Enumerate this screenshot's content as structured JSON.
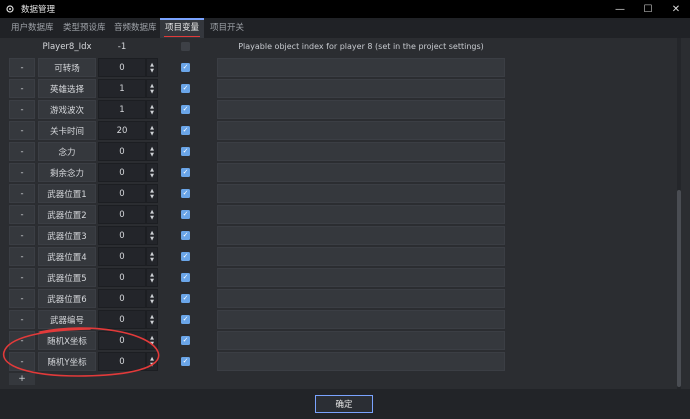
{
  "window": {
    "title": "数据管理",
    "icon": "gear-cog-icon"
  },
  "controls": {
    "minimize": "—",
    "maximize": "☐",
    "close": "✕"
  },
  "tabs": [
    {
      "label": "用户数据库"
    },
    {
      "label": "类型预设库"
    },
    {
      "label": "音频数据库"
    },
    {
      "label": "项目变量"
    },
    {
      "label": "项目开关"
    }
  ],
  "header": {
    "name": "Player8_Idx",
    "value": "-1",
    "description": "Playable object index for player 8 (set in the project settings)"
  },
  "rows": [
    {
      "del": "-",
      "name": "可转场",
      "value": "0",
      "checked": true
    },
    {
      "del": "-",
      "name": "英雄选择",
      "value": "1",
      "checked": true
    },
    {
      "del": "-",
      "name": "游戏波次",
      "value": "1",
      "checked": true
    },
    {
      "del": "-",
      "name": "关卡时间",
      "value": "20",
      "checked": true
    },
    {
      "del": "-",
      "name": "念力",
      "value": "0",
      "checked": true
    },
    {
      "del": "-",
      "name": "剩余念力",
      "value": "0",
      "checked": true
    },
    {
      "del": "-",
      "name": "武器位置1",
      "value": "0",
      "checked": true
    },
    {
      "del": "-",
      "name": "武器位置2",
      "value": "0",
      "checked": true
    },
    {
      "del": "-",
      "name": "武器位置3",
      "value": "0",
      "checked": true
    },
    {
      "del": "-",
      "name": "武器位置4",
      "value": "0",
      "checked": true
    },
    {
      "del": "-",
      "name": "武器位置5",
      "value": "0",
      "checked": true
    },
    {
      "del": "-",
      "name": "武器位置6",
      "value": "0",
      "checked": true
    },
    {
      "del": "-",
      "name": "武器编号",
      "value": "0",
      "checked": true
    },
    {
      "del": "-",
      "name": "随机X坐标",
      "value": "0",
      "checked": true
    },
    {
      "del": "-",
      "name": "随机Y坐标",
      "value": "0",
      "checked": true
    }
  ],
  "add_label": "+",
  "ok_label": "确定",
  "colors": {
    "accent": "#7aa3ff",
    "checkbox": "#6aa5e8",
    "annotation": "#e23a3a"
  }
}
